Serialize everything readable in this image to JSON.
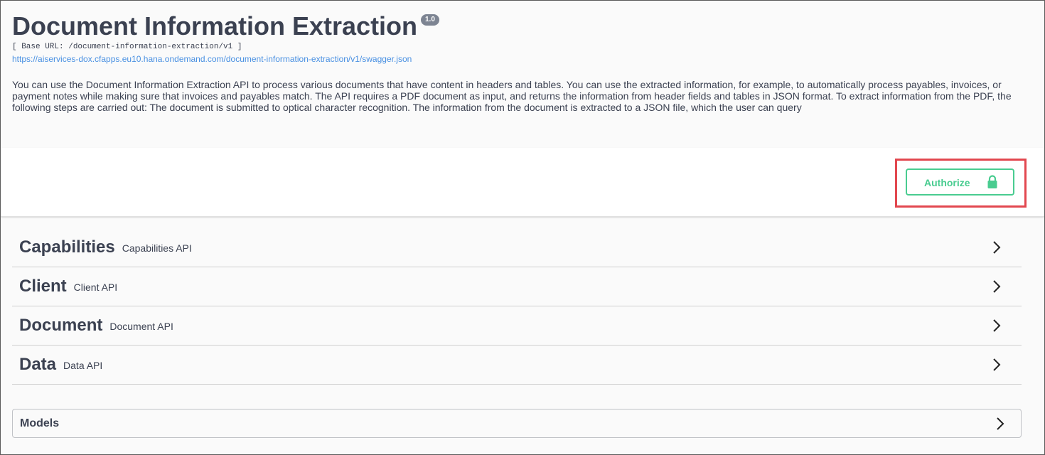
{
  "info": {
    "title": "Document Information Extraction",
    "version": "1.0",
    "base_url": "[ Base URL: /document-information-extraction/v1 ]",
    "spec_url": "https://aiservices-dox.cfapps.eu10.hana.ondemand.com/document-information-extraction/v1/swagger.json",
    "description": "You can use the Document Information Extraction API to process various documents that have content in headers and tables. You can use the extracted information, for example, to automatically process payables, invoices, or payment notes while making sure that invoices and payables match. The API requires a PDF document as input, and returns the information from header fields and tables in JSON format. To extract information from the PDF, the following steps are carried out: The document is submitted to optical character recognition. The information from the document is extracted to a JSON file, which the user can query"
  },
  "auth": {
    "button_label": "Authorize",
    "icon": "lock-icon"
  },
  "tags": [
    {
      "name": "Capabilities",
      "description": "Capabilities API"
    },
    {
      "name": "Client",
      "description": "Client API"
    },
    {
      "name": "Document",
      "description": "Document API"
    },
    {
      "name": "Data",
      "description": "Data API"
    }
  ],
  "models": {
    "title": "Models"
  },
  "colors": {
    "authorize_green": "#49cc90",
    "highlight_red": "#e2474f",
    "link_blue": "#4990e2",
    "text": "#3b4151"
  }
}
